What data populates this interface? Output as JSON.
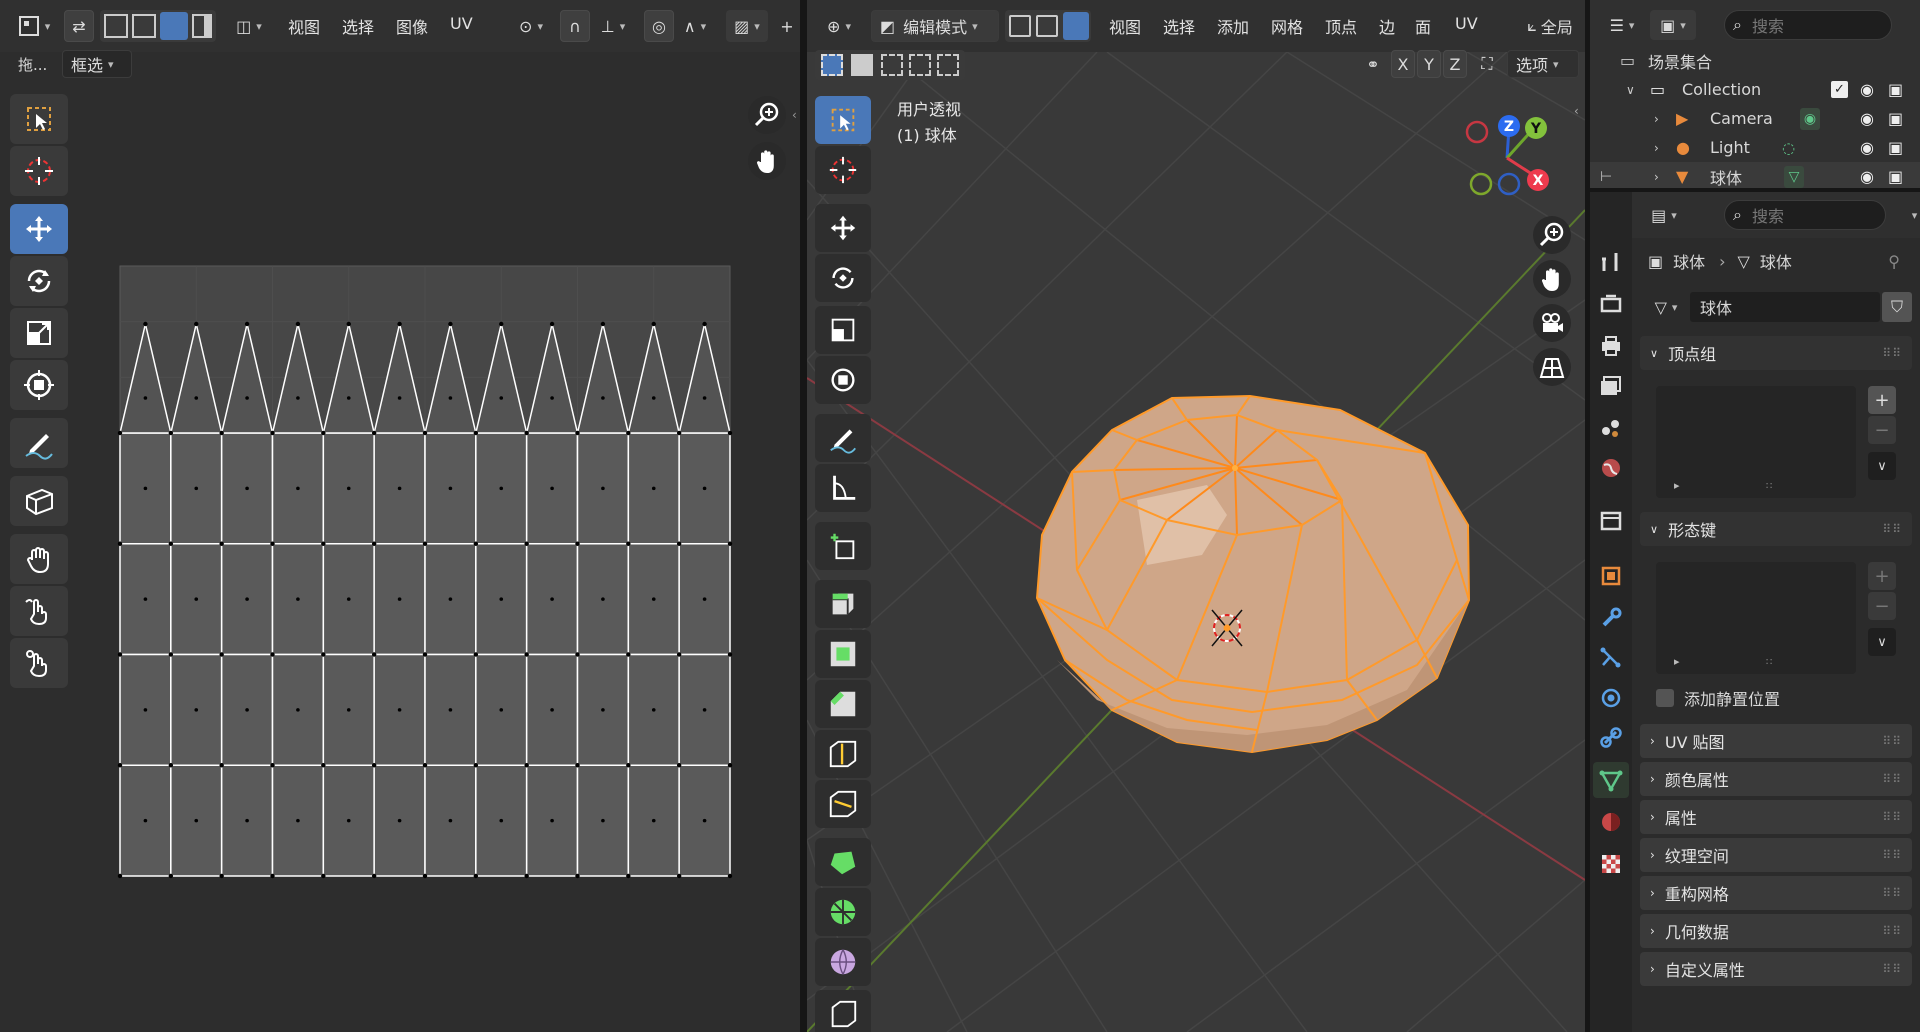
{
  "uv_editor": {
    "menus": [
      "视图",
      "选择",
      "图像",
      "UV"
    ],
    "drag_label": "拖...",
    "select_mode": "框选"
  },
  "viewport": {
    "mode": "编辑模式",
    "menus": [
      "视图",
      "选择",
      "添加",
      "网格",
      "顶点",
      "边",
      "面",
      "UV"
    ],
    "global_label": "全局",
    "axes": [
      "X",
      "Y",
      "Z"
    ],
    "options_label": "选项",
    "view_name": "用户透视",
    "object_label": "(1) 球体",
    "gizmo": {
      "x": "X",
      "y": "Y",
      "z": "Z"
    }
  },
  "outliner": {
    "search_placeholder": "搜索",
    "scene_collection": "场景集合",
    "items": [
      {
        "name": "Collection"
      },
      {
        "name": "Camera"
      },
      {
        "name": "Light"
      },
      {
        "name": "球体"
      }
    ]
  },
  "properties": {
    "search_placeholder": "搜索",
    "breadcrumb_object": "球体",
    "breadcrumb_data": "球体",
    "mesh_name": "球体",
    "vertex_groups": "顶点组",
    "shape_keys": "形态键",
    "add_rest_position": "添加静置位置",
    "panels": [
      "UV 贴图",
      "颜色属性",
      "属性",
      "纹理空间",
      "重构网格",
      "几何数据",
      "自定义属性"
    ]
  },
  "colors": {
    "accent": "#4a78b8",
    "selection": "#ffa030",
    "mesh_face": "#d1ac8e"
  }
}
